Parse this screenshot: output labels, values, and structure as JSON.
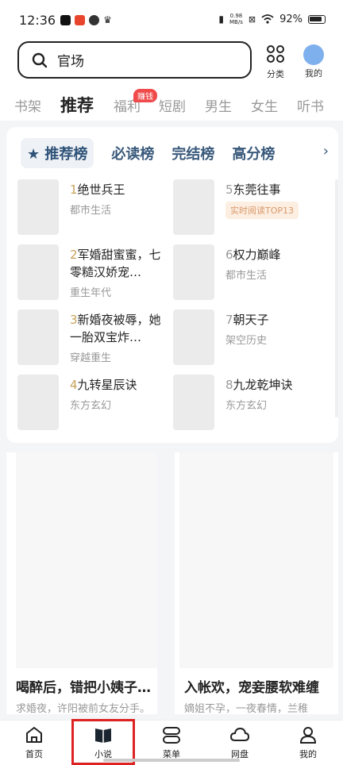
{
  "status_bar": {
    "time": "12:36",
    "net_speed_value": "0.98",
    "net_speed_unit": "MB/s",
    "battery": "92%"
  },
  "header": {
    "search_value": "官场",
    "category_label": "分类",
    "profile_label": "我的"
  },
  "tabs": [
    {
      "label": "书架"
    },
    {
      "label": "推荐"
    },
    {
      "label": "福利"
    },
    {
      "label": "短剧"
    },
    {
      "label": "男生"
    },
    {
      "label": "女生"
    },
    {
      "label": "听书"
    }
  ],
  "badge": "赚钱",
  "rank_tabs": [
    {
      "label": "推荐榜"
    },
    {
      "label": "必读榜"
    },
    {
      "label": "完结榜"
    },
    {
      "label": "高分榜"
    }
  ],
  "rank_items": [
    {
      "num": "1",
      "title": "绝世兵王",
      "genre": "都市生活",
      "tag": ""
    },
    {
      "num": "2",
      "title": "军婚甜蜜蜜，七零糙汉娇宠…",
      "genre": "重生年代",
      "tag": ""
    },
    {
      "num": "3",
      "title": "新婚夜被辱，她一胎双宝炸…",
      "genre": "穿越重生",
      "tag": ""
    },
    {
      "num": "4",
      "title": "九转星辰诀",
      "genre": "东方玄幻",
      "tag": ""
    },
    {
      "num": "5",
      "title": "东莞往事",
      "genre": "",
      "tag": "实时阅读TOP13"
    },
    {
      "num": "6",
      "title": "权力巅峰",
      "genre": "都市生活",
      "tag": ""
    },
    {
      "num": "7",
      "title": "朝天子",
      "genre": "架空历史",
      "tag": ""
    },
    {
      "num": "8",
      "title": "九龙乾坤诀",
      "genre": "东方玄幻",
      "tag": ""
    }
  ],
  "feed": [
    {
      "title": "喝醉后，错把小姨子…",
      "desc": "求婚夜，许阳被前女友分手。"
    },
    {
      "title": "入帐欢，宠妾腰软难缠",
      "desc": "嫡姐不孕，一夜春情，兰稚"
    }
  ],
  "bottom_nav": [
    {
      "label": "首页"
    },
    {
      "label": "小说"
    },
    {
      "label": "菜单"
    },
    {
      "label": "网盘"
    },
    {
      "label": "我的"
    }
  ]
}
